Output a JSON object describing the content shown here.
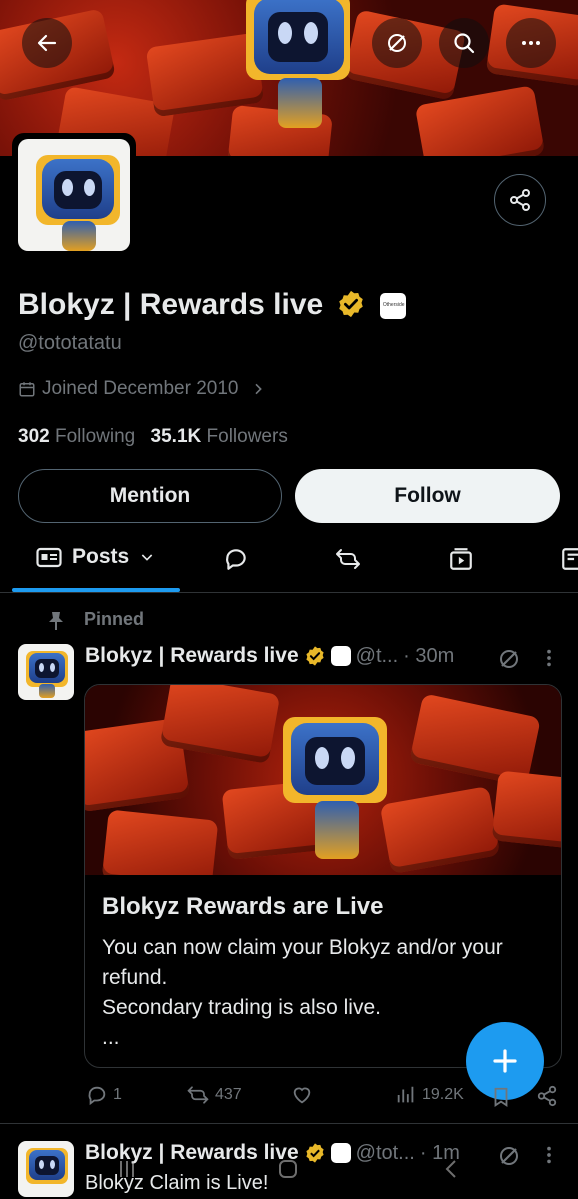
{
  "profile": {
    "display_name": "Blokyz | Rewards live",
    "handle": "@tototatatu",
    "joined": "Joined December 2010",
    "following_count": "302",
    "following_label": "Following",
    "followers_count": "35.1K",
    "followers_label": "Followers",
    "affiliate_badge_text": "Otherside"
  },
  "actions": {
    "mention_label": "Mention",
    "follow_label": "Follow"
  },
  "tabs": [
    {
      "label": "Posts",
      "icon": "posts-icon"
    },
    {
      "label": "",
      "icon": "replies-icon"
    },
    {
      "label": "",
      "icon": "reposts-icon"
    },
    {
      "label": "",
      "icon": "media-icon"
    },
    {
      "label": "",
      "icon": "articles-icon"
    }
  ],
  "pinned_label": "Pinned",
  "posts": [
    {
      "name": "Blokyz | Rewards live",
      "handle_trunc": "@t...",
      "time": "· 30m",
      "card": {
        "title": "Blokyz Rewards are Live",
        "text_line1": "You can now claim your Blokyz and/or your refund.",
        "text_line2": "Secondary trading is also live.",
        "text_line3": "..."
      },
      "replies": "1",
      "reposts": "437",
      "likes": "",
      "views": "19.2K"
    },
    {
      "name": "Blokyz | Rewards live",
      "handle_trunc": "@tot...",
      "time": "· 1m",
      "text": "Blokyz Claim is Live!"
    }
  ],
  "colors": {
    "accent": "#1d9bf0",
    "verified_gold": "#e8b829",
    "background": "#000000",
    "muted": "#71767b"
  }
}
